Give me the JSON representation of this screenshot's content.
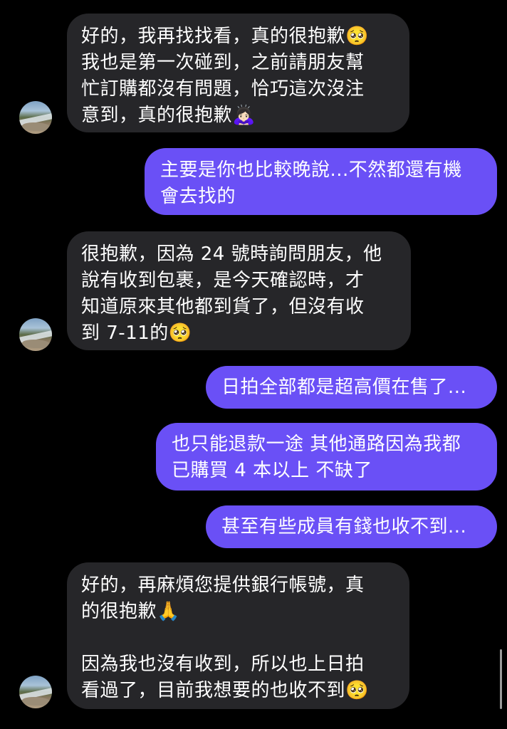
{
  "messages": [
    {
      "direction": "incoming",
      "text": "好的，我再找找看，真的很抱歉🥺\n我也是第一次碰到，之前請朋友幫\n忙訂購都沒有問題，恰巧這次沒注\n意到，真的很抱歉🙇🏻‍♀️"
    },
    {
      "direction": "outgoing",
      "text": "主要是你也比較晚說...不然都還有機\n會去找的"
    },
    {
      "direction": "incoming",
      "text": "很抱歉，因為 24 號時詢問朋友，他\n說有收到包裹，是今天確認時，才\n知道原來其他都到貨了，但沒有收\n到 7-11的🥺"
    },
    {
      "direction": "outgoing",
      "text": "日拍全部都是超高價在售了..."
    },
    {
      "direction": "outgoing",
      "text": "也只能退款一途 其他通路因為我都\n已購買 4 本以上 不缺了"
    },
    {
      "direction": "outgoing",
      "text": "甚至有些成員有錢也收不到..."
    },
    {
      "direction": "incoming",
      "text": "好的，再麻煩您提供銀行帳號，真\n的很抱歉🙏\n\n因為我也沒有收到，所以也上日拍\n看過了，目前我想要的也收不到🥺"
    }
  ],
  "colors": {
    "background": "#000000",
    "incoming_bubble": "#262629",
    "outgoing_bubble": "#6a50f6",
    "text": "#ffffff"
  },
  "icons": {
    "avatar": "profile-photo-seaside"
  }
}
